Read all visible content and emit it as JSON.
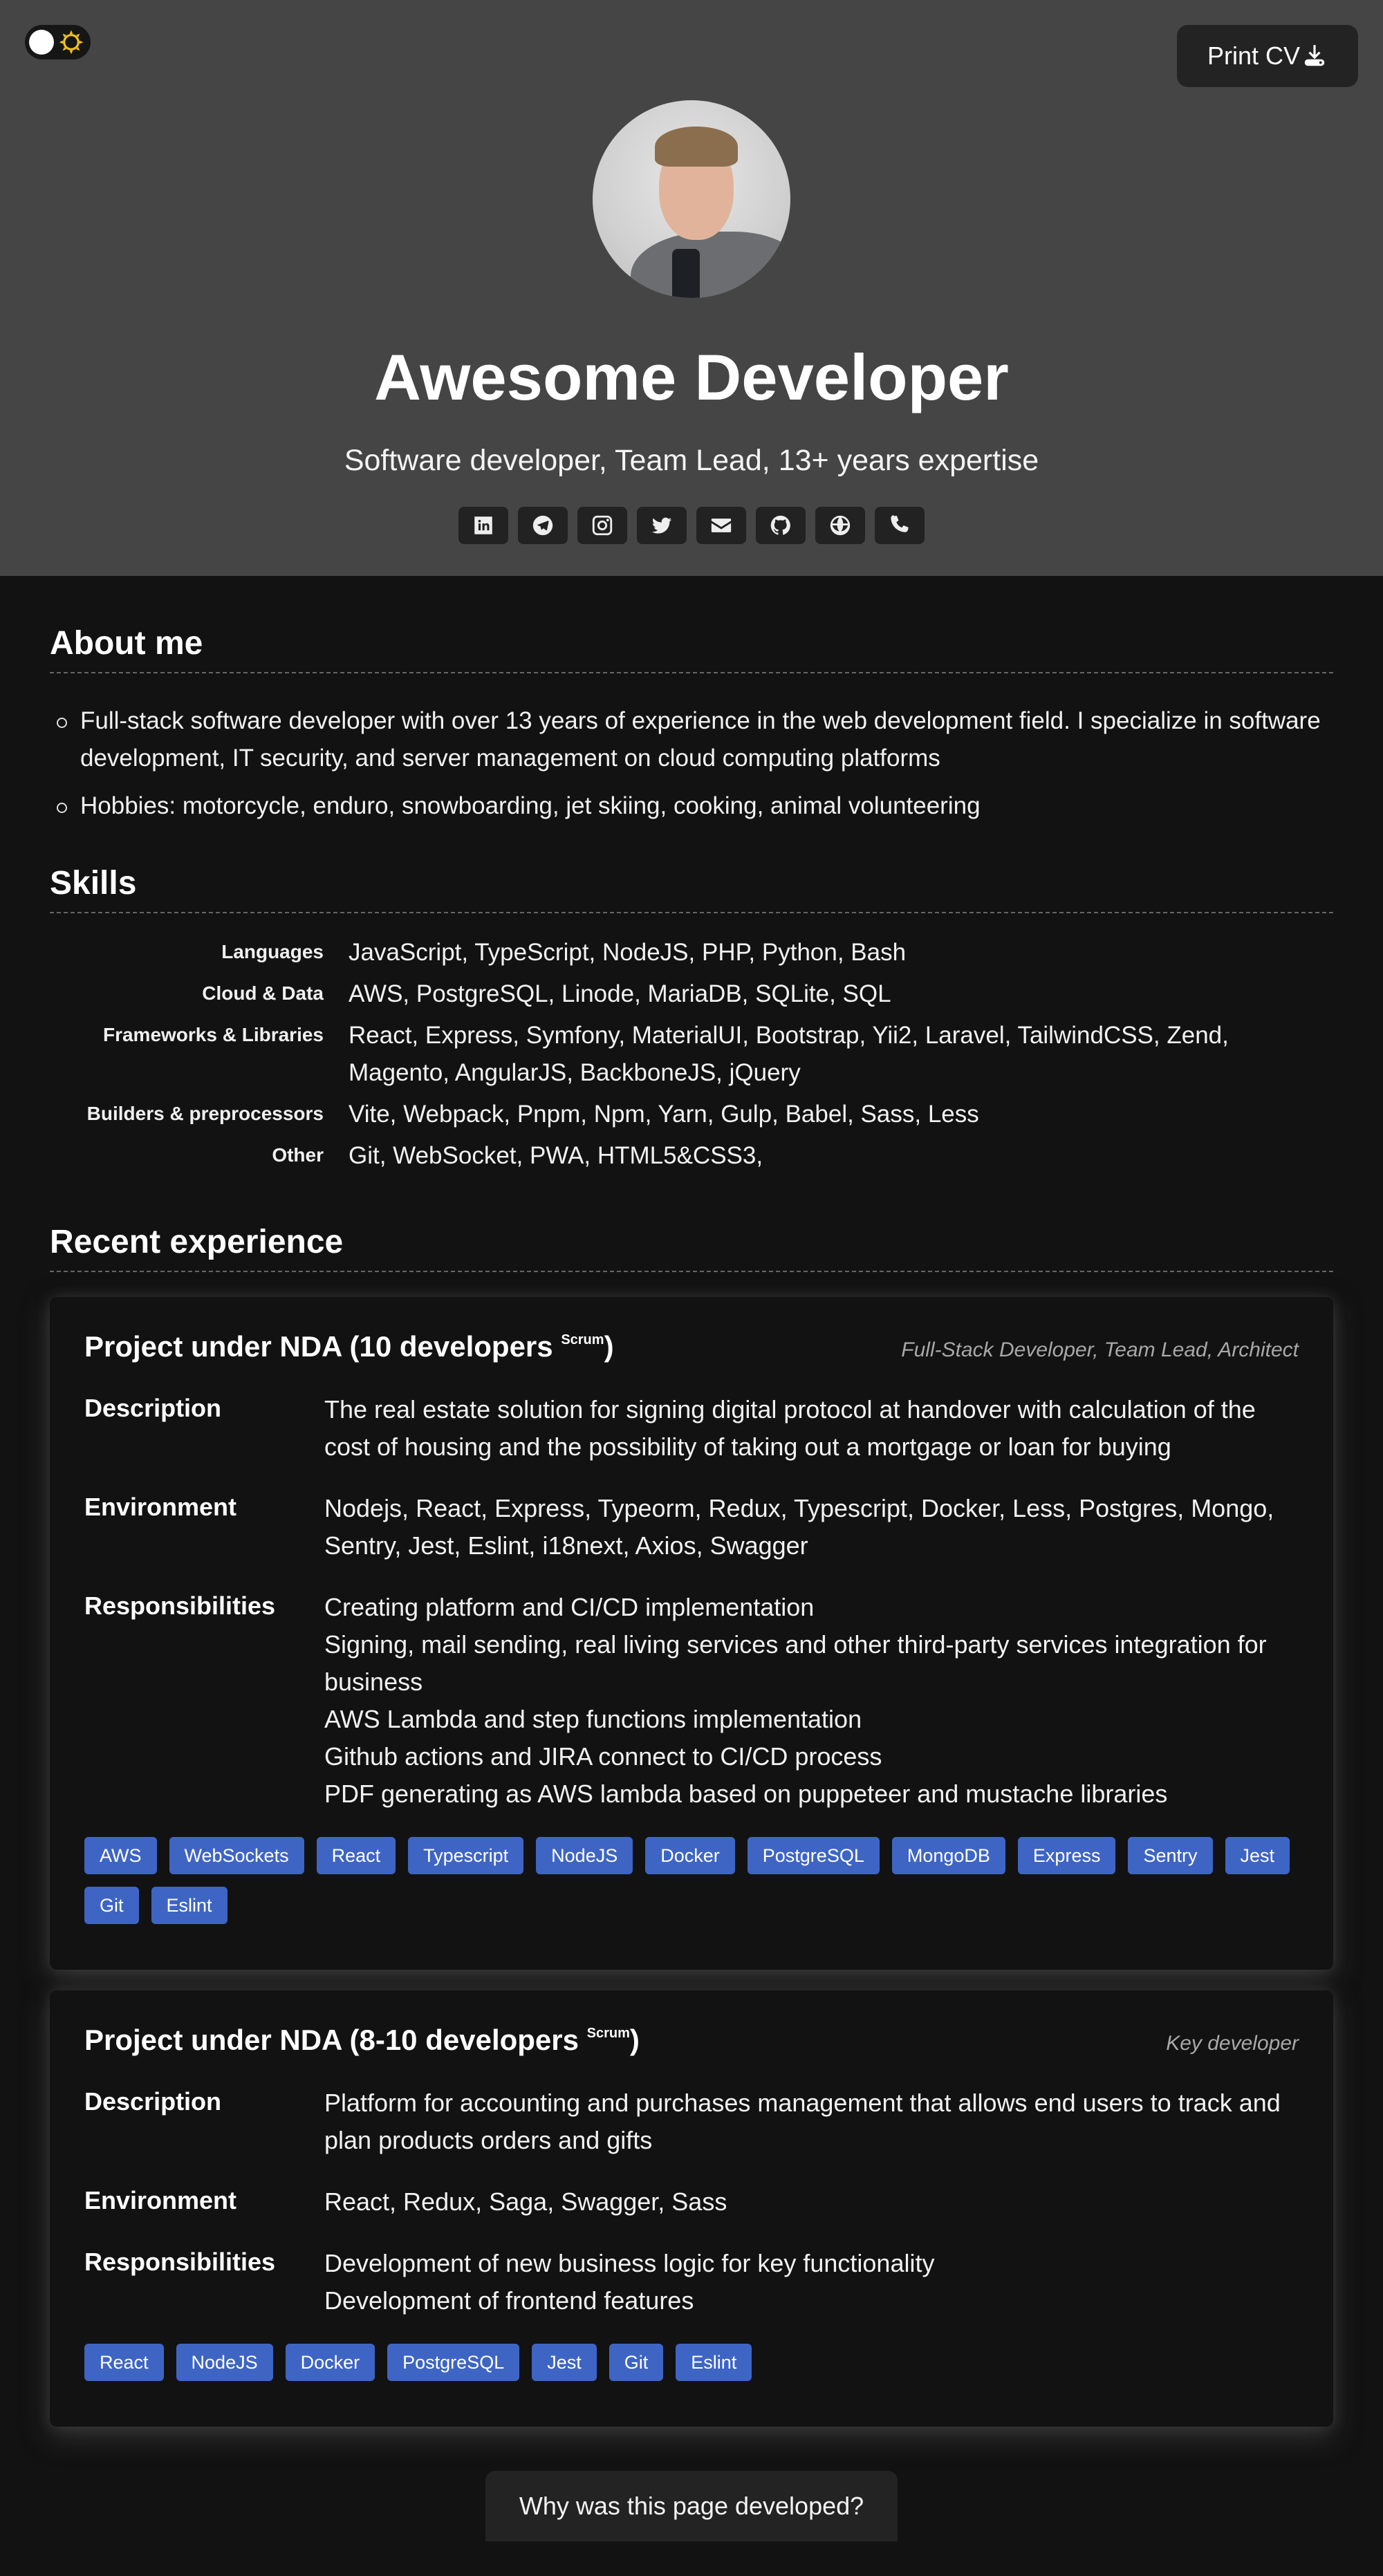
{
  "header": {
    "theme_toggle": {
      "state": "dark",
      "icon": "sun-icon"
    },
    "print_button": {
      "label": "Print CV",
      "icon": "download-icon"
    },
    "avatar_alt": "Profile photo",
    "name": "Awesome Developer",
    "subtitle": "Software developer, Team Lead, 13+ years expertise",
    "socials": [
      {
        "name": "linkedin",
        "icon": "linkedin-icon"
      },
      {
        "name": "telegram",
        "icon": "telegram-icon"
      },
      {
        "name": "instagram",
        "icon": "instagram-icon"
      },
      {
        "name": "twitter",
        "icon": "twitter-icon"
      },
      {
        "name": "email",
        "icon": "envelope-icon"
      },
      {
        "name": "github",
        "icon": "github-icon"
      },
      {
        "name": "website",
        "icon": "globe-icon"
      },
      {
        "name": "phone",
        "icon": "phone-icon"
      }
    ]
  },
  "about": {
    "title": "About me",
    "items": [
      "Full-stack software developer with over 13 years of experience in the web development field. I specialize in software development, IT security, and server management on cloud computing platforms",
      "Hobbies: motorcycle, enduro, snowboarding, jet skiing, cooking, animal volunteering"
    ]
  },
  "skills": {
    "title": "Skills",
    "rows": [
      {
        "label": "Languages",
        "value": "JavaScript, TypeScript, NodeJS, PHP, Python, Bash"
      },
      {
        "label": "Cloud & Data",
        "value": "AWS, PostgreSQL, Linode, MariaDB, SQLite, SQL"
      },
      {
        "label": "Frameworks & Libraries",
        "value": "React, Express, Symfony, MaterialUI, Bootstrap, Yii2, Laravel, TailwindCSS, Zend, Magento, AngularJS, BackboneJS, jQuery"
      },
      {
        "label": "Builders & preprocessors",
        "value": "Vite, Webpack, Pnpm, Npm, Yarn, Gulp, Babel, Sass, Less"
      },
      {
        "label": "Other",
        "value": "Git, WebSocket, PWA, HTML5&CSS3,"
      }
    ]
  },
  "experience": {
    "title": "Recent experience",
    "labels": {
      "description": "Description",
      "environment": "Environment",
      "responsibilities": "Responsibilities"
    },
    "projects": [
      {
        "title": "Project under NDA (10 developers ",
        "title_sup": "Scrum",
        "title_close": ")",
        "role": "Full-Stack Developer, Team Lead, Architect",
        "description": "The real estate solution for signing digital protocol at handover with calculation of the cost of housing and the possibility of taking out a mortgage or loan for buying",
        "environment": "Nodejs, React, Express, Typeorm, Redux, Typescript, Docker, Less, Postgres, Mongo, Sentry, Jest, Eslint, i18next, Axios, Swagger",
        "responsibilities": [
          "Creating platform and CI/CD implementation",
          "Signing, mail sending, real living services and other third-party services integration for business",
          "AWS Lambda and step functions implementation",
          "Github actions and JIRA connect to CI/CD process",
          "PDF generating as AWS lambda based on puppeteer and mustache libraries"
        ],
        "tags": [
          "AWS",
          "WebSockets",
          "React",
          "Typescript",
          "NodeJS",
          "Docker",
          "PostgreSQL",
          "MongoDB",
          "Express",
          "Sentry",
          "Jest",
          "Git",
          "Eslint"
        ]
      },
      {
        "title": "Project under NDA (8-10 developers ",
        "title_sup": "Scrum",
        "title_close": ")",
        "role": "Key developer",
        "description": "Platform for accounting and purchases management that allows end users to track and plan products orders and gifts",
        "environment": "React, Redux, Saga, Swagger, Sass",
        "responsibilities": [
          "Development of new business logic for key functionality",
          "Development of frontend features"
        ],
        "tags": [
          "React",
          "NodeJS",
          "Docker",
          "PostgreSQL",
          "Jest",
          "Git",
          "Eslint"
        ]
      }
    ]
  },
  "footer": {
    "why_button": "Why was this page developed?"
  },
  "colors": {
    "header_bg": "#454545",
    "page_bg": "#121212",
    "tag_bg": "#3e65c4",
    "button_bg": "#232323",
    "sun_yellow": "#f2c21b"
  }
}
